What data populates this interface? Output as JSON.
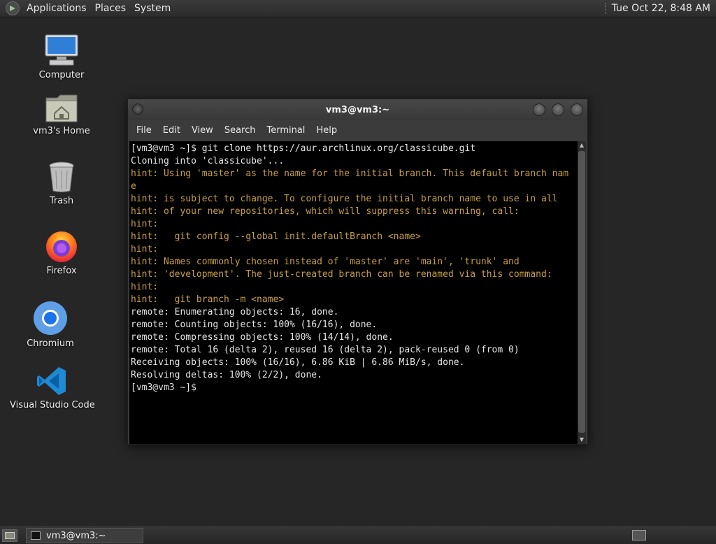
{
  "top_panel": {
    "menus": [
      "Applications",
      "Places",
      "System"
    ],
    "clock": "Tue Oct 22,  8:48 AM"
  },
  "desktop_icons": [
    {
      "label": "Computer",
      "icon": "computer-icon"
    },
    {
      "label": "vm3's Home",
      "icon": "home-folder-icon"
    },
    {
      "label": "Trash",
      "icon": "trash-icon"
    },
    {
      "label": "Firefox",
      "icon": "firefox-icon"
    },
    {
      "label": "Chromium",
      "icon": "chromium-icon"
    },
    {
      "label": "Visual Studio Code",
      "icon": "vscode-icon"
    }
  ],
  "window": {
    "title": "vm3@vm3:~",
    "menu": [
      "File",
      "Edit",
      "View",
      "Search",
      "Terminal",
      "Help"
    ]
  },
  "terminal": {
    "colors": {
      "normal": "#e6e6e6",
      "hint": "#c8a040"
    },
    "lines": [
      {
        "text": "[vm3@vm3 ~]$ git clone https://aur.archlinux.org/classicube.git",
        "kind": "normal"
      },
      {
        "text": "Cloning into 'classicube'...",
        "kind": "normal"
      },
      {
        "text": "hint: Using 'master' as the name for the initial branch. This default branch nam",
        "kind": "hint"
      },
      {
        "text": "e",
        "kind": "hint"
      },
      {
        "text": "hint: is subject to change. To configure the initial branch name to use in all",
        "kind": "hint"
      },
      {
        "text": "hint: of your new repositories, which will suppress this warning, call:",
        "kind": "hint"
      },
      {
        "text": "hint:",
        "kind": "hint"
      },
      {
        "text": "hint:   git config --global init.defaultBranch <name>",
        "kind": "hint"
      },
      {
        "text": "hint:",
        "kind": "hint"
      },
      {
        "text": "hint: Names commonly chosen instead of 'master' are 'main', 'trunk' and",
        "kind": "hint"
      },
      {
        "text": "hint: 'development'. The just-created branch can be renamed via this command:",
        "kind": "hint"
      },
      {
        "text": "hint:",
        "kind": "hint"
      },
      {
        "text": "hint:   git branch -m <name>",
        "kind": "hint"
      },
      {
        "text": "remote: Enumerating objects: 16, done.",
        "kind": "normal"
      },
      {
        "text": "remote: Counting objects: 100% (16/16), done.",
        "kind": "normal"
      },
      {
        "text": "remote: Compressing objects: 100% (14/14), done.",
        "kind": "normal"
      },
      {
        "text": "remote: Total 16 (delta 2), reused 16 (delta 2), pack-reused 0 (from 0)",
        "kind": "normal"
      },
      {
        "text": "Receiving objects: 100% (16/16), 6.86 KiB | 6.86 MiB/s, done.",
        "kind": "normal"
      },
      {
        "text": "Resolving deltas: 100% (2/2), done.",
        "kind": "normal"
      },
      {
        "text": "[vm3@vm3 ~]$",
        "kind": "normal"
      }
    ]
  },
  "taskbar": {
    "task_label": "vm3@vm3:~"
  }
}
